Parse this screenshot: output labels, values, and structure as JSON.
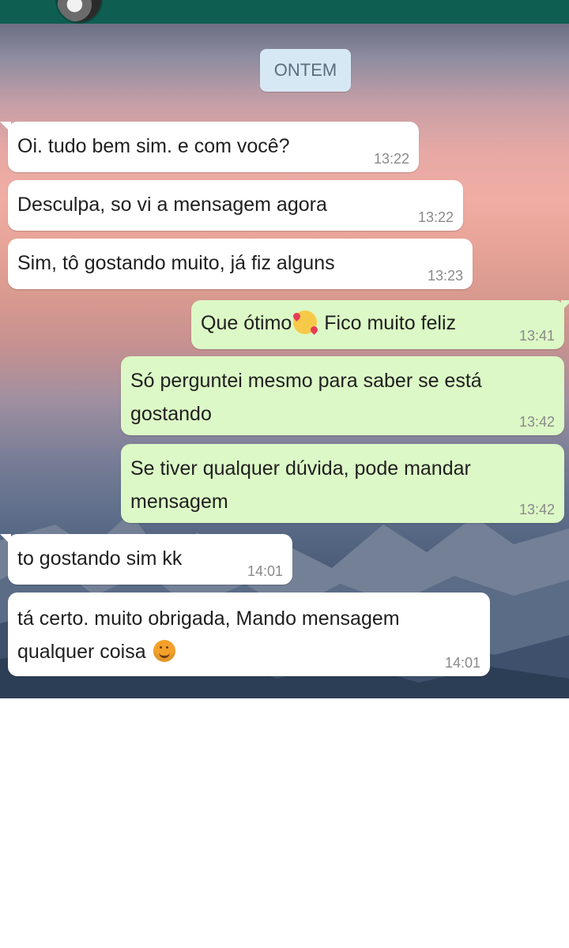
{
  "chat": {
    "date_label": "ONTEM",
    "messages": [
      {
        "text": "Oi. tudo bem sim. e com você?",
        "time": "13:22"
      },
      {
        "text": "Desculpa, so vi a mensagem agora",
        "time": "13:22"
      },
      {
        "text": "Sim, tô gostando muito, já fiz alguns",
        "time": "13:23"
      },
      {
        "text_before": "Que ótimo",
        "text_after": " Fico muito feliz",
        "time": "13:41",
        "emoji": "smiling-face-with-hearts"
      },
      {
        "line1": "Só perguntei mesmo para saber se está",
        "line2": "gostando",
        "time": "13:42"
      },
      {
        "line1": "Se tiver qualquer dúvida, pode mandar",
        "line2": "mensagem",
        "time": "13:42"
      },
      {
        "text": "to gostando sim kk",
        "time": "14:01"
      },
      {
        "line1": "tá certo. muito obrigada, Mando mensagem",
        "line2": "qualquer coisa",
        "time": "14:01",
        "emoji": "smiling-face"
      }
    ]
  },
  "colors": {
    "header": "#0f5e52",
    "incoming_bubble": "#ffffff",
    "outgoing_bubble": "#dcf8c6",
    "date_chip": "#d7e8f5"
  }
}
